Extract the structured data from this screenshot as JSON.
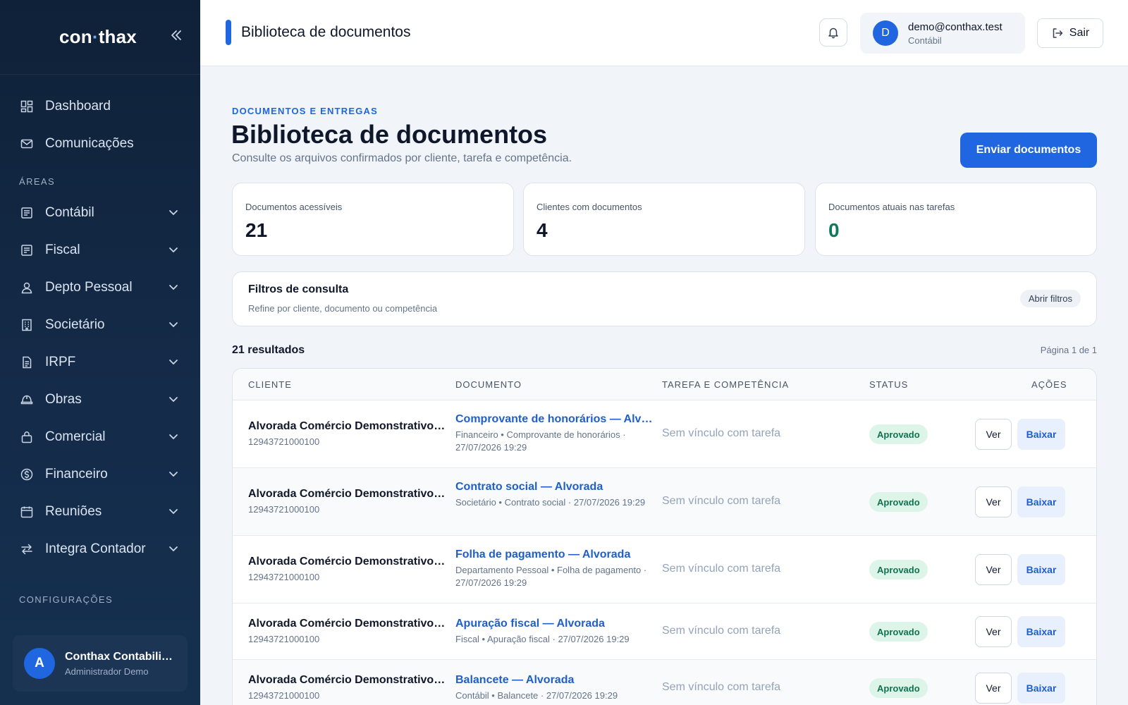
{
  "app": {
    "logo_left": "con",
    "logo_right": "thax"
  },
  "sidebar": {
    "top_items": [
      {
        "label": "Dashboard",
        "icon": "dashboard-icon"
      },
      {
        "label": "Comunicações",
        "icon": "mail-icon"
      }
    ],
    "areas_label": "ÁREAS",
    "area_items": [
      {
        "label": "Contábil",
        "icon": "ledger-icon"
      },
      {
        "label": "Fiscal",
        "icon": "receipt-icon"
      },
      {
        "label": "Depto Pessoal",
        "icon": "person-icon"
      },
      {
        "label": "Societário",
        "icon": "building-icon"
      },
      {
        "label": "IRPF",
        "icon": "document-icon"
      },
      {
        "label": "Obras",
        "icon": "helmet-icon"
      },
      {
        "label": "Comercial",
        "icon": "bag-icon"
      },
      {
        "label": "Financeiro",
        "icon": "dollar-circle-icon"
      },
      {
        "label": "Reuniões",
        "icon": "calendar-icon"
      },
      {
        "label": "Integra Contador",
        "icon": "swap-icon"
      }
    ],
    "config_label": "CONFIGURAÇÕES",
    "user": {
      "initial": "A",
      "name": "Conthax Contabilidade",
      "role": "Administrador Demo"
    }
  },
  "topbar": {
    "title": "Biblioteca de documentos",
    "account": {
      "initial": "D",
      "email": "demo@conthax.test",
      "role": "Contábil"
    },
    "logout_label": "Sair"
  },
  "page": {
    "kicker": "DOCUMENTOS E ENTREGAS",
    "title": "Biblioteca de documentos",
    "subtitle": "Consulte os arquivos confirmados por cliente, tarefa e competência.",
    "primary_button": "Enviar documentos"
  },
  "stats": [
    {
      "label": "Documentos acessíveis",
      "value": "21"
    },
    {
      "label": "Clientes com documentos",
      "value": "4"
    },
    {
      "label": "Documentos atuais nas tarefas",
      "value": "0"
    }
  ],
  "filters": {
    "title": "Filtros de consulta",
    "subtitle": "Refine por cliente, documento ou competência",
    "button": "Abrir filtros"
  },
  "results": {
    "count_label": "21 resultados",
    "page_label": "Página 1 de 1"
  },
  "table": {
    "headers": {
      "client": "CLIENTE",
      "document": "DOCUMENTO",
      "task": "TAREFA E COMPETÊNCIA",
      "status": "STATUS",
      "actions": "AÇÕES"
    },
    "rows": [
      {
        "client": "Alvorada Comércio Demonstrativo Ltda",
        "cnpj": "12943721000100",
        "doc_title": "Comprovante de honorários — Alvorada",
        "doc_meta": "Financeiro • Comprovante de honorários · 27/07/2026 19:29",
        "task": "Sem vínculo com tarefa",
        "status": "Aprovado",
        "view": "Ver",
        "download": "Baixar"
      },
      {
        "client": "Alvorada Comércio Demonstrativo Ltda",
        "cnpj": "12943721000100",
        "doc_title": "Contrato social — Alvorada",
        "doc_meta": "Societário • Contrato social · 27/07/2026 19:29",
        "task": "Sem vínculo com tarefa",
        "status": "Aprovado",
        "view": "Ver",
        "download": "Baixar"
      },
      {
        "client": "Alvorada Comércio Demonstrativo Ltda",
        "cnpj": "12943721000100",
        "doc_title": "Folha de pagamento — Alvorada",
        "doc_meta": "Departamento Pessoal • Folha de pagamento · 27/07/2026 19:29",
        "task": "Sem vínculo com tarefa",
        "status": "Aprovado",
        "view": "Ver",
        "download": "Baixar"
      },
      {
        "client": "Alvorada Comércio Demonstrativo Ltda",
        "cnpj": "12943721000100",
        "doc_title": "Apuração fiscal — Alvorada",
        "doc_meta": "Fiscal • Apuração fiscal · 27/07/2026 19:29",
        "task": "Sem vínculo com tarefa",
        "status": "Aprovado",
        "view": "Ver",
        "download": "Baixar"
      },
      {
        "client": "Alvorada Comércio Demonstrativo Ltda",
        "cnpj": "12943721000100",
        "doc_title": "Balancete — Alvorada",
        "doc_meta": "Contábil • Balancete · 27/07/2026 19:29",
        "task": "Sem vínculo com tarefa",
        "status": "Aprovado",
        "view": "Ver",
        "download": "Baixar"
      }
    ]
  }
}
